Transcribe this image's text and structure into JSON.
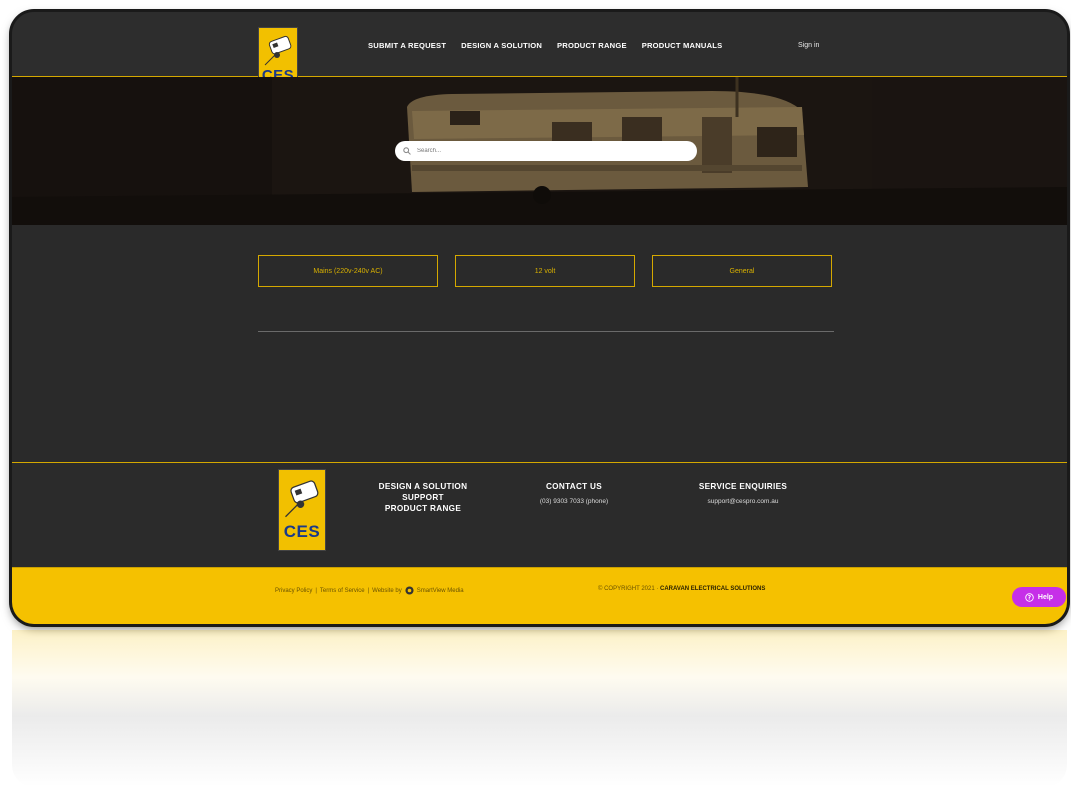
{
  "brand": {
    "logo_text": "CES"
  },
  "nav": {
    "items": [
      "SUBMIT A REQUEST",
      "DESIGN A SOLUTION",
      "PRODUCT RANGE",
      "PRODUCT MANUALS"
    ],
    "signin": "Sign in"
  },
  "search": {
    "placeholder": "Search..."
  },
  "categories": [
    "Mains (220v-240v AC)",
    "12 volt",
    "General"
  ],
  "footer": {
    "links_col": [
      "DESIGN A SOLUTION",
      "SUPPORT",
      "PRODUCT RANGE"
    ],
    "contact": {
      "heading": "CONTACT US",
      "phone": "(03) 9303 7033 (phone)"
    },
    "service": {
      "heading": "SERVICE ENQUIRIES",
      "email": "support@cespro.com.au"
    }
  },
  "bottom": {
    "privacy": "Privacy Policy",
    "terms": "Terms of Service",
    "website_by": "Website by",
    "agency": "SmartView Media",
    "copyright": "© COPYRIGHT 2021 ·",
    "company": "CARAVAN ELECTRICAL SOLUTIONS"
  },
  "help": {
    "label": "Help"
  },
  "colors": {
    "accent": "#f5c100",
    "background": "#2a2a2a",
    "help": "#c62fe8"
  }
}
